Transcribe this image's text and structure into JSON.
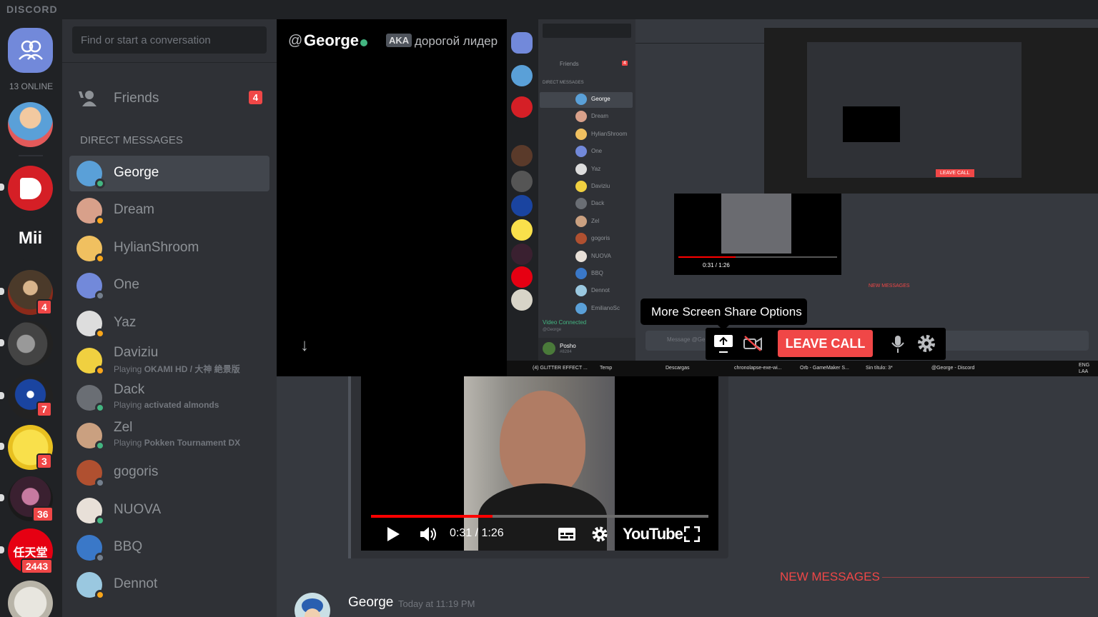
{
  "app": {
    "title": "DISCORD"
  },
  "servers": {
    "online_count": "13 ONLINE",
    "items": [
      {
        "name": "server-1",
        "badge": ""
      },
      {
        "name": "server-2",
        "badge": ""
      },
      {
        "name": "Mii",
        "label": "Mii",
        "badge": ""
      },
      {
        "name": "server-4",
        "badge": "4"
      },
      {
        "name": "server-5",
        "badge": ""
      },
      {
        "name": "server-6",
        "badge": "7"
      },
      {
        "name": "server-7",
        "badge": "3"
      },
      {
        "name": "server-8",
        "badge": "36"
      },
      {
        "name": "nintendo",
        "label": "任天堂",
        "badge": "2443"
      },
      {
        "name": "server-10",
        "badge": ""
      }
    ]
  },
  "sidebar": {
    "search_placeholder": "Find or start a conversation",
    "friends_label": "Friends",
    "friends_count": "4",
    "dm_header": "DIRECT MESSAGES",
    "dms": [
      {
        "name": "George",
        "status": "online",
        "activity": ""
      },
      {
        "name": "Dream",
        "status": "idle",
        "activity": ""
      },
      {
        "name": "HylianShroom",
        "status": "idle",
        "activity": ""
      },
      {
        "name": "One",
        "status": "offline",
        "activity": ""
      },
      {
        "name": "Yaz",
        "status": "idle",
        "activity": ""
      },
      {
        "name": "Daviziu",
        "status": "idle",
        "activity_prefix": "Playing ",
        "activity": "OKAMI HD / 大神 絶景版"
      },
      {
        "name": "Dack",
        "status": "online",
        "activity_prefix": "Playing ",
        "activity": "activated almonds"
      },
      {
        "name": "Zel",
        "status": "online",
        "activity_prefix": "Playing ",
        "activity": "Pokken Tournament DX"
      },
      {
        "name": "gogoris",
        "status": "offline",
        "activity": ""
      },
      {
        "name": "NUOVA",
        "status": "online",
        "activity": ""
      },
      {
        "name": "BBQ",
        "status": "offline",
        "activity": ""
      },
      {
        "name": "Dennot",
        "status": "idle",
        "activity": ""
      }
    ]
  },
  "chat": {
    "at_symbol": "@",
    "recipient": "George",
    "aka_label": "AKA",
    "aka_text": "дорогой лидер",
    "new_messages": "NEW MESSAGES",
    "message_author": "George",
    "message_time": "Today at 11:19 PM"
  },
  "screenshare": {
    "tooltip": "More Screen Share Options",
    "leave_call": "LEAVE CALL",
    "inner_dm_header": "DIRECT MESSAGES",
    "inner_friends": "Friends",
    "inner_friends_count": "4",
    "inner_dms": [
      "George",
      "Dream",
      "HylianShroom",
      "One",
      "Yaz",
      "Daviziu",
      "Dack",
      "Zel",
      "gogoris",
      "NUOVA",
      "BBQ",
      "Dennot",
      "EmilianoSc"
    ],
    "inner_voice": "Video Connected",
    "inner_voice_sub": "@George",
    "inner_user": "Posho",
    "inner_user_tag": "#8284",
    "inner_new_messages": "NEW MESSAGES",
    "inner_message_placeholder": "Message @Ge"
  },
  "taskbar": {
    "items": [
      "(4) GLITTER EFFECT ...",
      "Temp",
      "Descargas",
      "chronolapse-exe-wi...",
      "Orb - GameMaker S...",
      "Sin título: 3*",
      "@George - Discord"
    ],
    "lang": "ENG",
    "region": "LAA"
  },
  "video": {
    "time": "0:31 / 1:26",
    "played_fraction": 0.36,
    "logo": "YouTube",
    "inner_time": "0:31 / 1:26"
  },
  "colors": {
    "accent": "#7289da",
    "danger": "#f04747",
    "online": "#43b581",
    "idle": "#faa61a",
    "offline": "#747f8d"
  }
}
